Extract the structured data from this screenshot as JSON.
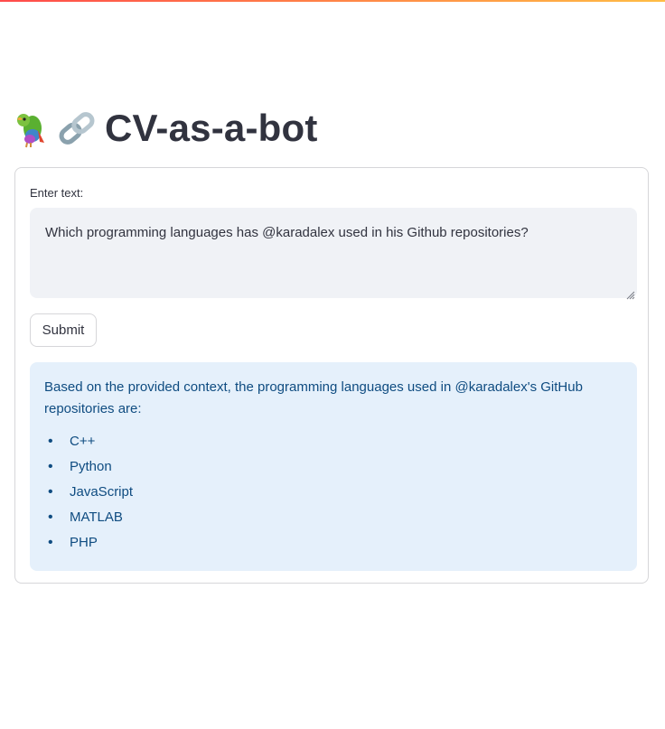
{
  "header": {
    "title": "CV-as-a-bot",
    "emoji": [
      "parrot-icon",
      "link-icon"
    ],
    "accent_gradient": [
      "#ff4b4b",
      "#ffbd45"
    ]
  },
  "form": {
    "input_label": "Enter text:",
    "input_value": "Which programming languages has @karadalex used in his Github repositories?",
    "submit_label": "Submit"
  },
  "answer": {
    "text": "Based on the provided context, the programming languages used in @karadalex's GitHub repositories are:",
    "languages": [
      "C++",
      "Python",
      "JavaScript",
      "MATLAB",
      "PHP"
    ],
    "background_color": "#e5f0fb",
    "text_color": "#0f4c81"
  }
}
